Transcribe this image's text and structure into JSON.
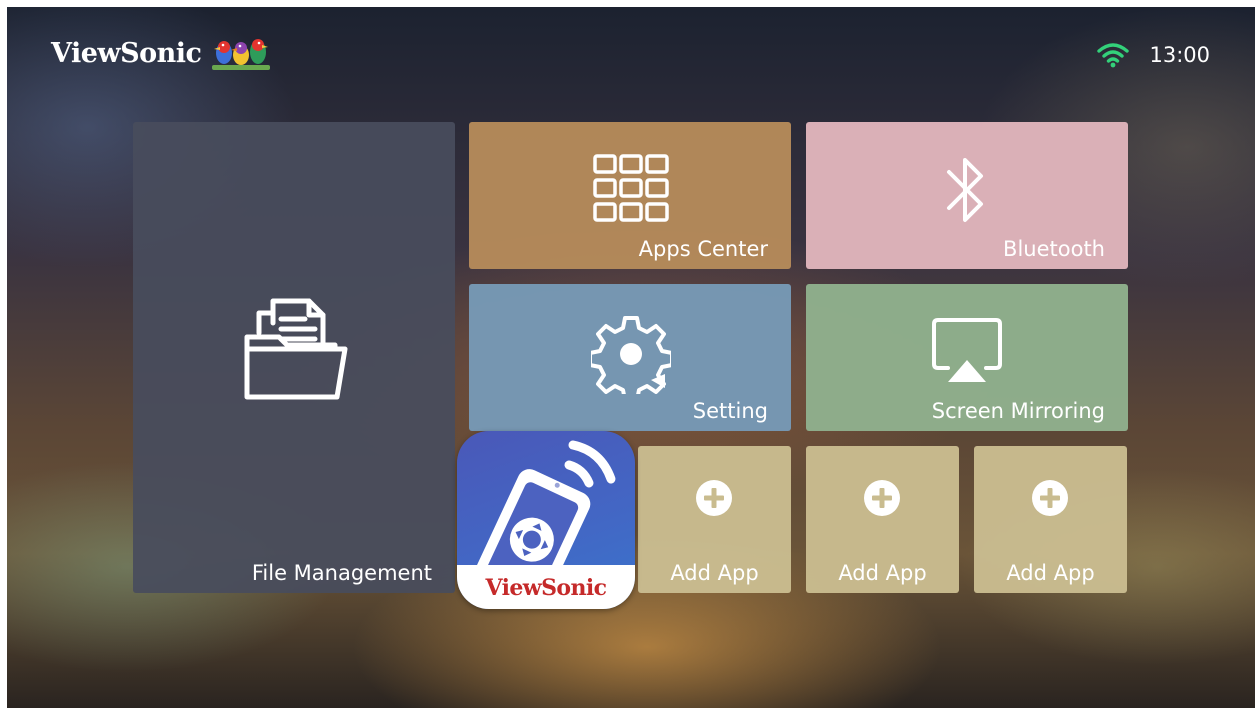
{
  "brand": {
    "name": "ViewSonic"
  },
  "status": {
    "time": "13:00",
    "wifi_icon": "wifi-icon"
  },
  "tiles": {
    "file_management": {
      "label": "File Management",
      "icon": "folder-documents-icon",
      "color": "#484c5c"
    },
    "apps_center": {
      "label": "Apps Center",
      "icon": "app-grid-icon",
      "color": "#b58a5a"
    },
    "bluetooth": {
      "label": "Bluetooth",
      "icon": "bluetooth-icon",
      "color": "#ddb2ba"
    },
    "setting": {
      "label": "Setting",
      "icon": "gear-icon",
      "color": "#7698b4"
    },
    "screen_mirroring": {
      "label": "Screen Mirroring",
      "icon": "screen-cast-icon",
      "color": "#8fae8c"
    },
    "remote_app": {
      "brand": "ViewSonic",
      "icon": "remote-control-icon"
    },
    "add_apps": [
      {
        "label": "Add App",
        "icon": "plus-circle-icon"
      },
      {
        "label": "Add App",
        "icon": "plus-circle-icon"
      },
      {
        "label": "Add App",
        "icon": "plus-circle-icon"
      }
    ]
  }
}
